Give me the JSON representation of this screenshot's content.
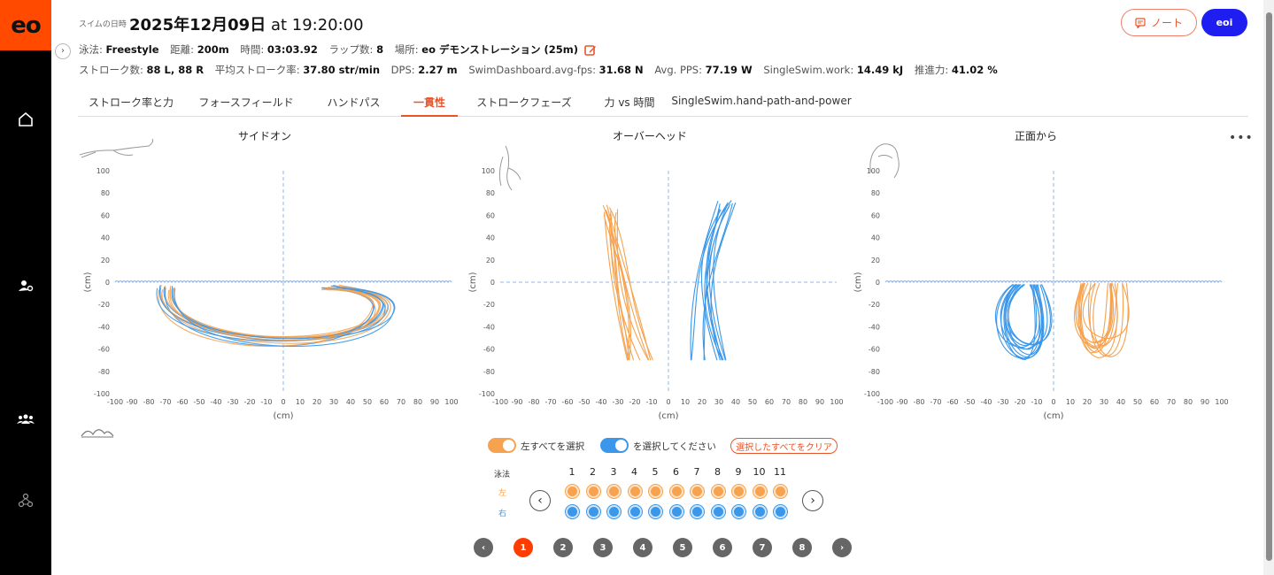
{
  "logo": "eo",
  "header": {
    "datetime_label": "スイムの日時",
    "date": "2025年12月09日",
    "time": "at 19:20:00",
    "note_button": "ノート",
    "user_button": "eoi"
  },
  "info_row1": [
    {
      "label": "泳法:",
      "value": "Freestyle"
    },
    {
      "label": "距離:",
      "value": "200m"
    },
    {
      "label": "時間:",
      "value": "03:03.92"
    },
    {
      "label": "ラップ数:",
      "value": "8"
    },
    {
      "label": "場所:",
      "value": "eo デモンストレーション (25m)"
    }
  ],
  "info_row2": [
    {
      "label": "ストローク数:",
      "value": "88 L, 88 R"
    },
    {
      "label": "平均ストローク率:",
      "value": "37.80 str/min"
    },
    {
      "label": "DPS:",
      "value": "2.27 m"
    },
    {
      "label": "SwimDashboard.avg-fps:",
      "value": "31.68 N"
    },
    {
      "label": "Avg. PPS:",
      "value": "77.19 W"
    },
    {
      "label": "SingleSwim.work:",
      "value": "14.49 kJ"
    },
    {
      "label": "推進力:",
      "value": "41.02 %"
    }
  ],
  "tabs": [
    {
      "label": "ストローク率と力",
      "active": false
    },
    {
      "label": "フォースフィールド",
      "active": false
    },
    {
      "label": "ハンドパス",
      "active": false
    },
    {
      "label": "一貫性",
      "active": true
    },
    {
      "label": "ストロークフェーズ",
      "active": false
    },
    {
      "label": "力 vs 時間",
      "active": false
    },
    {
      "label": "SingleSwim.hand-path-and-power",
      "active": false
    }
  ],
  "charts": {
    "side": {
      "title": "サイドオン"
    },
    "overhead": {
      "title": "オーバーヘッド"
    },
    "front": {
      "title": "正面から"
    },
    "axis_unit": "(cm)",
    "x_ticks": [
      "-100",
      "-90",
      "-80",
      "-70",
      "-60",
      "-50",
      "-40",
      "-30",
      "-20",
      "-10",
      "0",
      "10",
      "20",
      "30",
      "40",
      "50",
      "60",
      "70",
      "80",
      "90",
      "100"
    ],
    "y_ticks": [
      "100",
      "80",
      "60",
      "40",
      "20",
      "0",
      "-20",
      "-40",
      "-60",
      "-80",
      "-100"
    ]
  },
  "chart_data": [
    {
      "type": "line",
      "title": "サイドオン",
      "xlabel": "(cm)",
      "ylabel": "(cm)",
      "xlim": [
        -100,
        100
      ],
      "ylim": [
        -100,
        100
      ]
    },
    {
      "type": "line",
      "title": "オーバーヘッド",
      "xlabel": "(cm)",
      "ylabel": "(cm)",
      "xlim": [
        -100,
        100
      ],
      "ylim": [
        -100,
        100
      ]
    },
    {
      "type": "line",
      "title": "正面から",
      "xlabel": "(cm)",
      "ylabel": "(cm)",
      "xlim": [
        -100,
        100
      ],
      "ylim": [
        -100,
        100
      ]
    }
  ],
  "controls": {
    "select_left": "左すべてを選択",
    "select_right": "を選択してください",
    "clear": "選択したすべてをクリア",
    "stroke_label": "泳法",
    "left_label": "左",
    "right_label": "右",
    "laps": [
      "1",
      "2",
      "3",
      "4",
      "5",
      "6",
      "7",
      "8",
      "9",
      "10",
      "11"
    ]
  },
  "pagination": {
    "pages": [
      "1",
      "2",
      "3",
      "4",
      "5",
      "6",
      "7",
      "8"
    ],
    "active": "1"
  },
  "colors": {
    "left": "#f6a24f",
    "right": "#3a97ea",
    "accent": "#ff4a00",
    "water": "#8fb7ea"
  }
}
